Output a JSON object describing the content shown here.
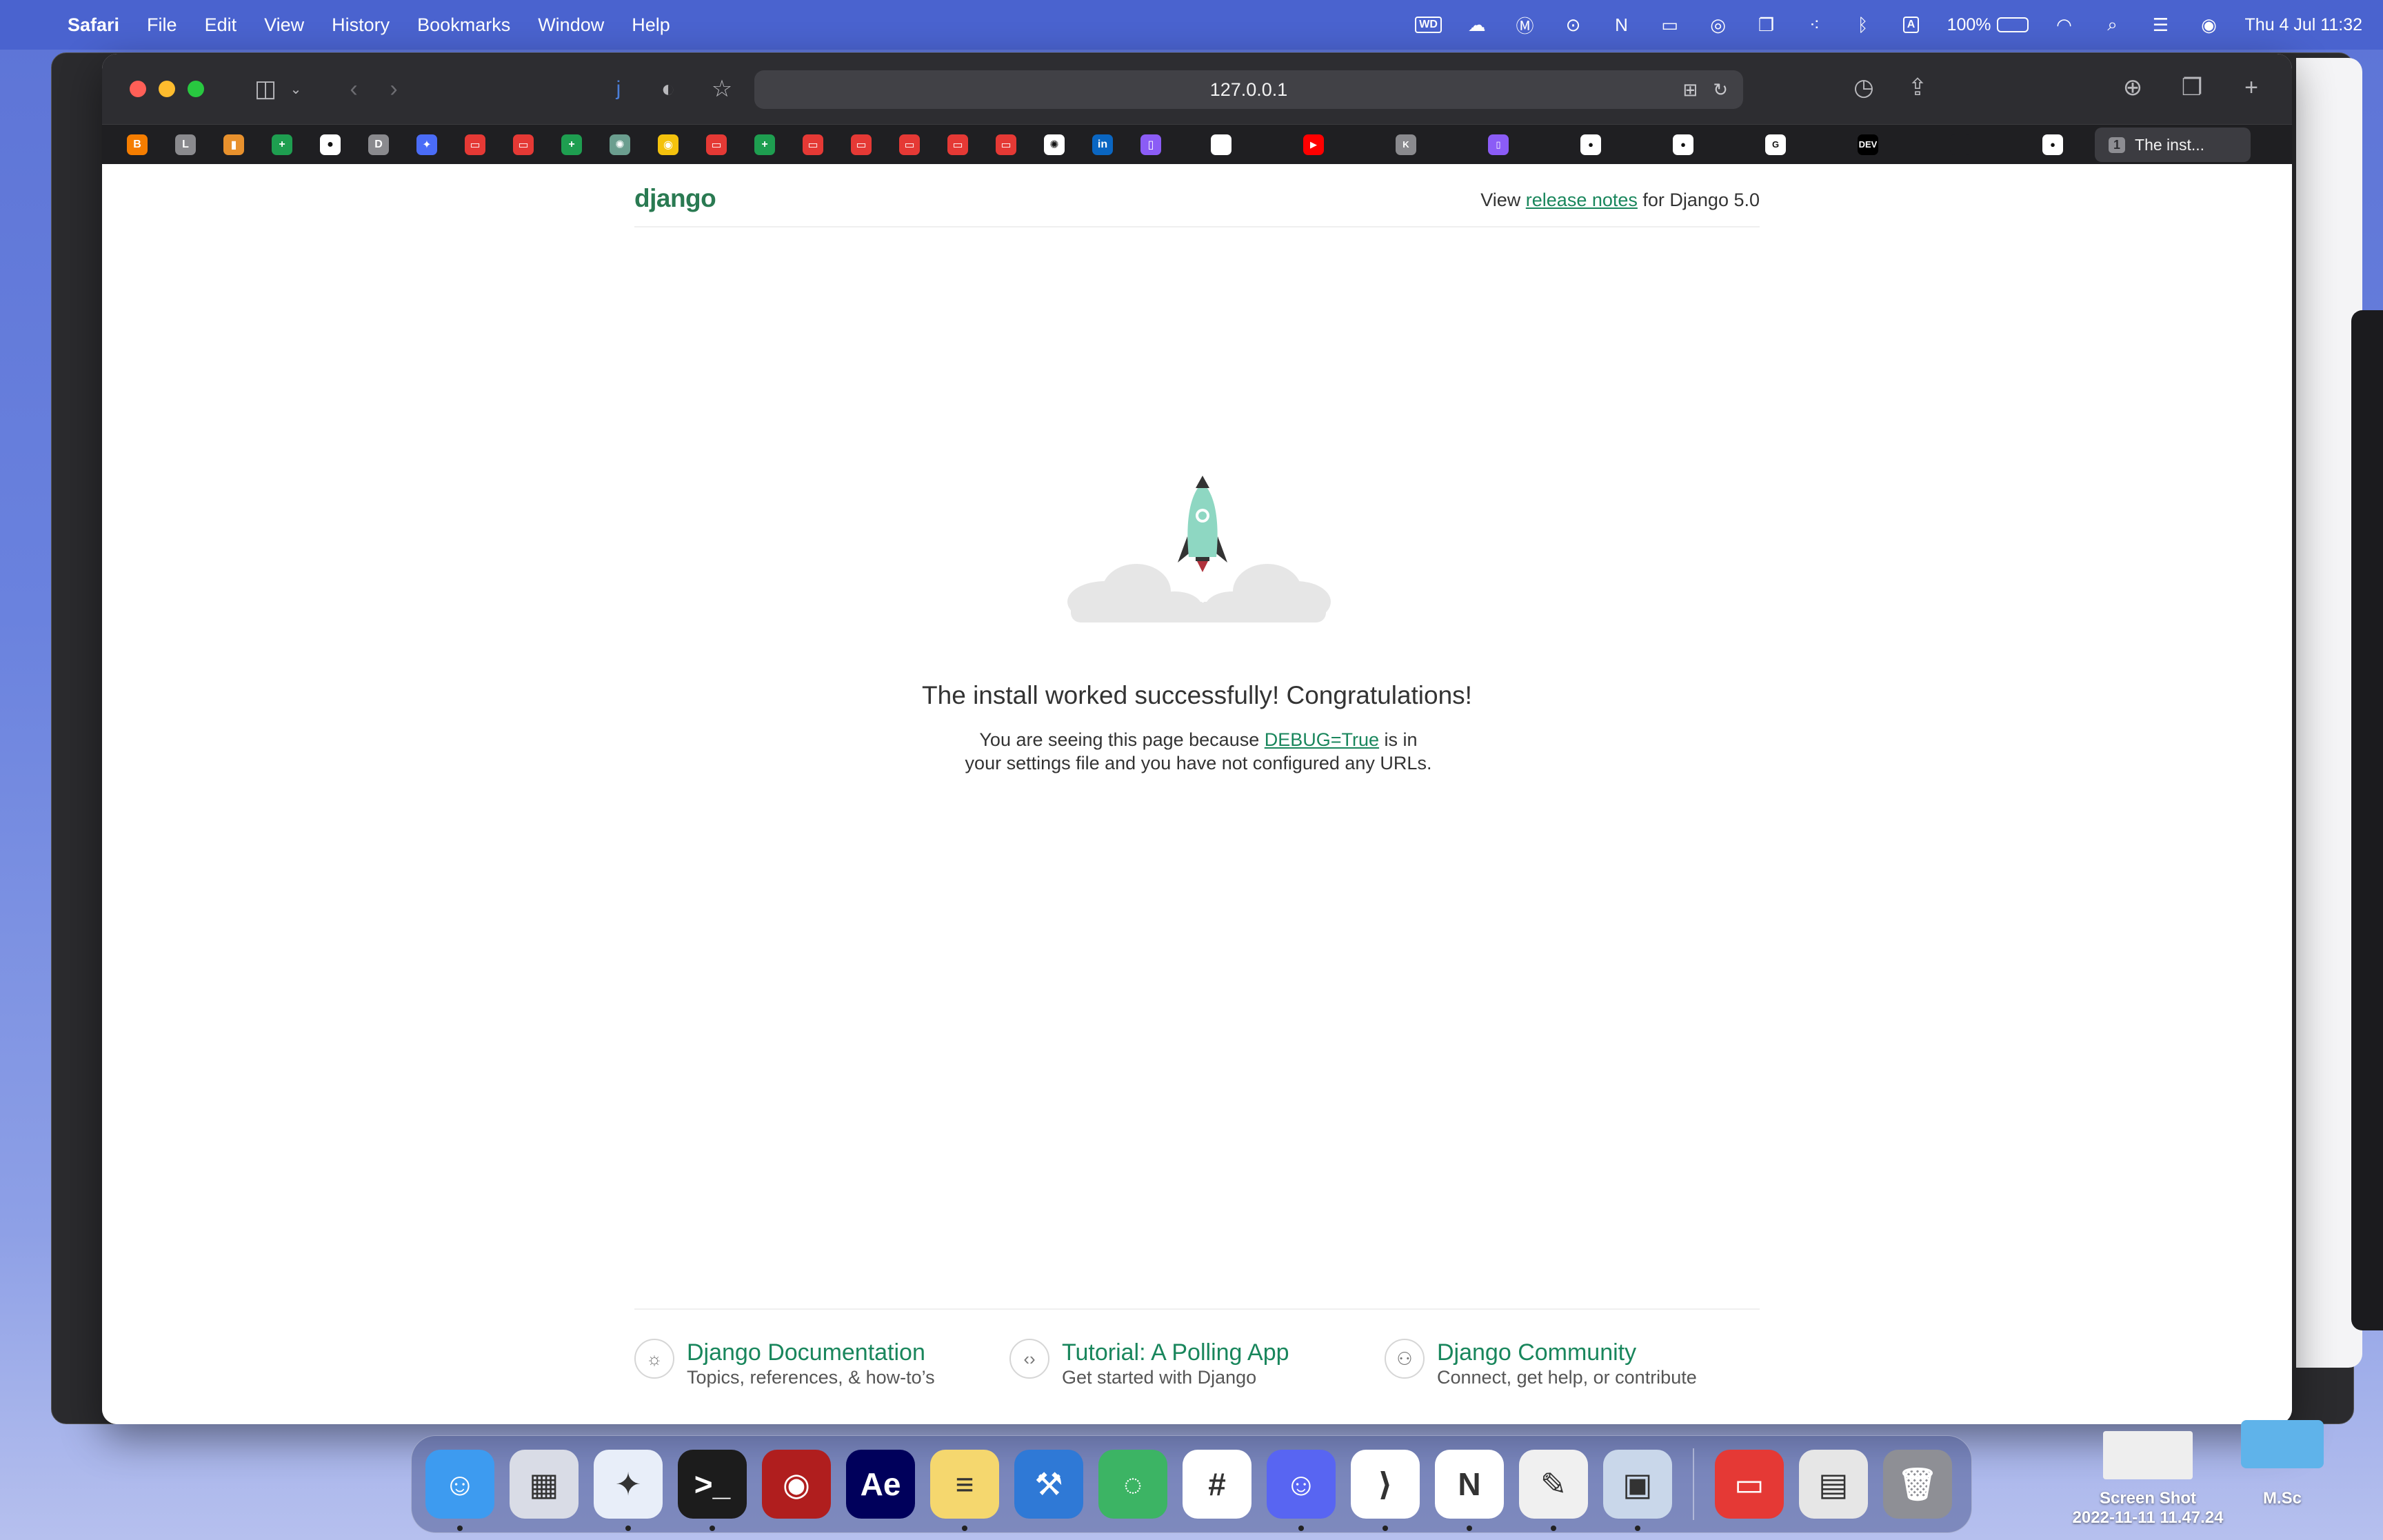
{
  "menubar": {
    "app_name": "Safari",
    "menus": [
      "File",
      "Edit",
      "View",
      "History",
      "Bookmarks",
      "Window",
      "Help"
    ],
    "battery": "100%",
    "clock": "Thu 4 Jul  11:32",
    "status_box_icons": {
      "wd": "WD",
      "keyboard": "A"
    }
  },
  "browser": {
    "address": "127.0.0.1",
    "active_tab": {
      "count": "1",
      "title": "The inst..."
    },
    "pinned_tabs": [
      {
        "name": "blogger",
        "color": "#f57d00",
        "glyph": "B"
      },
      {
        "name": "l-site",
        "color": "#8a8a8e",
        "glyph": "L"
      },
      {
        "name": "books",
        "color": "#e8912d",
        "glyph": "▮"
      },
      {
        "name": "sheets",
        "color": "#1e9e50",
        "glyph": "+"
      },
      {
        "name": "circle",
        "color": "#ffffff",
        "glyph": "●"
      },
      {
        "name": "d-site",
        "color": "#8a8a8e",
        "glyph": "D"
      },
      {
        "name": "gemini",
        "color": "#4a6cf7",
        "glyph": "✦"
      },
      {
        "name": "bus-1",
        "color": "#e53935",
        "glyph": "▭"
      },
      {
        "name": "bus-2",
        "color": "#e53935",
        "glyph": "▭"
      },
      {
        "name": "sheets-2",
        "color": "#1e9e50",
        "glyph": "+"
      },
      {
        "name": "chatgpt",
        "color": "#6b9e8f",
        "glyph": "✺"
      },
      {
        "name": "chrome",
        "color": "#f4c20d",
        "glyph": "◉"
      },
      {
        "name": "bus-3",
        "color": "#e53935",
        "glyph": "▭"
      },
      {
        "name": "sheets-3",
        "color": "#1e9e50",
        "glyph": "+"
      },
      {
        "name": "bus-4",
        "color": "#e53935",
        "glyph": "▭"
      },
      {
        "name": "bus-5",
        "color": "#e53935",
        "glyph": "▭"
      },
      {
        "name": "bus-6",
        "color": "#e53935",
        "glyph": "▭"
      },
      {
        "name": "bus-7",
        "color": "#e53935",
        "glyph": "▭"
      },
      {
        "name": "bus-8",
        "color": "#e53935",
        "glyph": "▭"
      },
      {
        "name": "openai",
        "color": "#ffffff",
        "glyph": "✺"
      },
      {
        "name": "linkedin",
        "color": "#0a66c2",
        "glyph": "in"
      },
      {
        "name": "proton",
        "color": "#8b5cf6",
        "glyph": "▯"
      }
    ],
    "wide_tabs": [
      {
        "name": "blank",
        "color": "#ffffff",
        "glyph": ""
      },
      {
        "name": "youtube",
        "color": "#ff0000",
        "glyph": "▶"
      },
      {
        "name": "k-site",
        "color": "#8a8a8e",
        "glyph": "K"
      },
      {
        "name": "proton-2",
        "color": "#8b5cf6",
        "glyph": "▯"
      },
      {
        "name": "github-1",
        "color": "#ffffff",
        "glyph": "●"
      },
      {
        "name": "github-2",
        "color": "#ffffff",
        "glyph": "●"
      },
      {
        "name": "google",
        "color": "#ffffff",
        "glyph": "G"
      },
      {
        "name": "dev",
        "color": "#000000",
        "glyph": "DEV"
      },
      {
        "name": "apple",
        "color": "#1f1f22",
        "glyph": ""
      },
      {
        "name": "github-3",
        "color": "#ffffff",
        "glyph": "●"
      }
    ]
  },
  "django": {
    "logo": "django",
    "release_prefix": "View ",
    "release_link": "release notes",
    "release_suffix": " for Django 5.0",
    "headline": "The install worked successfully! Congratulations!",
    "sub_prefix": "You are seeing this page because ",
    "sub_link": "DEBUG=True",
    "sub_suffix": " is in your settings file and you have not configured any URLs.",
    "footer": [
      {
        "title": "Django Documentation",
        "subtitle": "Topics, references, & how-to’s",
        "icon": "lightbulb-icon"
      },
      {
        "title": "Tutorial: A Polling App",
        "subtitle": "Get started with Django",
        "icon": "code-icon"
      },
      {
        "title": "Django Community",
        "subtitle": "Connect, get help, or contribute",
        "icon": "people-icon"
      }
    ]
  },
  "dock": {
    "apps": [
      {
        "name": "finder",
        "bg": "#3d9bf0",
        "glyph": "☺",
        "running": true
      },
      {
        "name": "launchpad",
        "bg": "#d9dce6",
        "glyph": "▦",
        "running": false
      },
      {
        "name": "safari",
        "bg": "#e8eef9",
        "glyph": "✦",
        "running": true
      },
      {
        "name": "terminal",
        "bg": "#1c1c1c",
        "glyph": ">_",
        "running": true
      },
      {
        "name": "radar",
        "bg": "#b01e1e",
        "glyph": "◉",
        "running": false
      },
      {
        "name": "after-effects",
        "bg": "#00005b",
        "glyph": "Ae",
        "running": false
      },
      {
        "name": "stickies",
        "bg": "#f5d76e",
        "glyph": "≡",
        "running": true
      },
      {
        "name": "xcode",
        "bg": "#2f79d6",
        "glyph": "⚒",
        "running": false
      },
      {
        "name": "circle-app",
        "bg": "#3cb464",
        "glyph": "◌",
        "running": false
      },
      {
        "name": "slack",
        "bg": "#ffffff",
        "glyph": "#",
        "running": false
      },
      {
        "name": "discord",
        "bg": "#5865f2",
        "glyph": "☺",
        "running": true
      },
      {
        "name": "vscode",
        "bg": "#ffffff",
        "glyph": "⟩",
        "running": true
      },
      {
        "name": "notion",
        "bg": "#ffffff",
        "glyph": "N",
        "running": true
      },
      {
        "name": "textedit",
        "bg": "#f0f0f0",
        "glyph": "✎",
        "running": true
      },
      {
        "name": "preview",
        "bg": "#c9d7ea",
        "glyph": "▣",
        "running": true
      }
    ],
    "right_apps": [
      {
        "name": "bus-app",
        "bg": "#e53935",
        "glyph": "▭",
        "running": false
      },
      {
        "name": "document-stack",
        "bg": "#e6e6e6",
        "glyph": "▤",
        "running": false
      },
      {
        "name": "trash",
        "bg": "#8e8f95",
        "glyph": "🗑",
        "running": false
      }
    ]
  },
  "desktop": {
    "screenshot_label_1": "Screen Shot",
    "screenshot_label_2": "2022-11-11 11.47.24",
    "folder_label": "M.Sc"
  }
}
